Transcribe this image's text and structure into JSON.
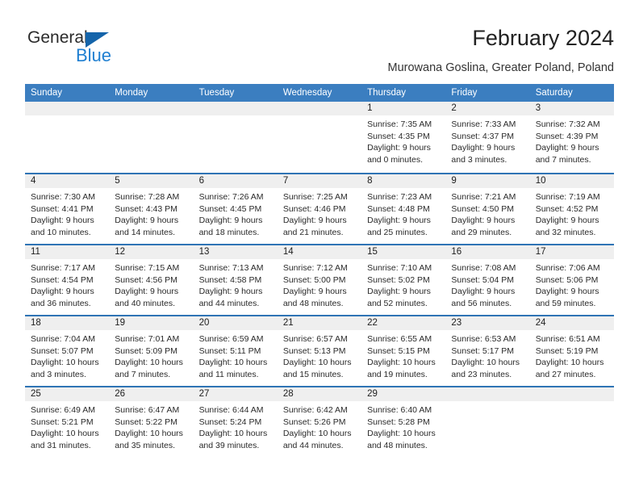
{
  "brand": {
    "name_part1": "General",
    "name_part2": "Blue",
    "accent_color": "#1f7fd1",
    "triangle_color": "#1464aa"
  },
  "header": {
    "title": "February 2024",
    "location": "Murowana Goslina, Greater Poland, Poland"
  },
  "theme": {
    "header_row_bg": "#3b7ec0",
    "week_separator": "#2f74b5",
    "day_band_bg": "#efefef"
  },
  "weekdays": [
    "Sunday",
    "Monday",
    "Tuesday",
    "Wednesday",
    "Thursday",
    "Friday",
    "Saturday"
  ],
  "weeks": [
    [
      {
        "day": "",
        "lines": []
      },
      {
        "day": "",
        "lines": []
      },
      {
        "day": "",
        "lines": []
      },
      {
        "day": "",
        "lines": []
      },
      {
        "day": "1",
        "lines": [
          "Sunrise: 7:35 AM",
          "Sunset: 4:35 PM",
          "Daylight: 9 hours",
          "and 0 minutes."
        ]
      },
      {
        "day": "2",
        "lines": [
          "Sunrise: 7:33 AM",
          "Sunset: 4:37 PM",
          "Daylight: 9 hours",
          "and 3 minutes."
        ]
      },
      {
        "day": "3",
        "lines": [
          "Sunrise: 7:32 AM",
          "Sunset: 4:39 PM",
          "Daylight: 9 hours",
          "and 7 minutes."
        ]
      }
    ],
    [
      {
        "day": "4",
        "lines": [
          "Sunrise: 7:30 AM",
          "Sunset: 4:41 PM",
          "Daylight: 9 hours",
          "and 10 minutes."
        ]
      },
      {
        "day": "5",
        "lines": [
          "Sunrise: 7:28 AM",
          "Sunset: 4:43 PM",
          "Daylight: 9 hours",
          "and 14 minutes."
        ]
      },
      {
        "day": "6",
        "lines": [
          "Sunrise: 7:26 AM",
          "Sunset: 4:45 PM",
          "Daylight: 9 hours",
          "and 18 minutes."
        ]
      },
      {
        "day": "7",
        "lines": [
          "Sunrise: 7:25 AM",
          "Sunset: 4:46 PM",
          "Daylight: 9 hours",
          "and 21 minutes."
        ]
      },
      {
        "day": "8",
        "lines": [
          "Sunrise: 7:23 AM",
          "Sunset: 4:48 PM",
          "Daylight: 9 hours",
          "and 25 minutes."
        ]
      },
      {
        "day": "9",
        "lines": [
          "Sunrise: 7:21 AM",
          "Sunset: 4:50 PM",
          "Daylight: 9 hours",
          "and 29 minutes."
        ]
      },
      {
        "day": "10",
        "lines": [
          "Sunrise: 7:19 AM",
          "Sunset: 4:52 PM",
          "Daylight: 9 hours",
          "and 32 minutes."
        ]
      }
    ],
    [
      {
        "day": "11",
        "lines": [
          "Sunrise: 7:17 AM",
          "Sunset: 4:54 PM",
          "Daylight: 9 hours",
          "and 36 minutes."
        ]
      },
      {
        "day": "12",
        "lines": [
          "Sunrise: 7:15 AM",
          "Sunset: 4:56 PM",
          "Daylight: 9 hours",
          "and 40 minutes."
        ]
      },
      {
        "day": "13",
        "lines": [
          "Sunrise: 7:13 AM",
          "Sunset: 4:58 PM",
          "Daylight: 9 hours",
          "and 44 minutes."
        ]
      },
      {
        "day": "14",
        "lines": [
          "Sunrise: 7:12 AM",
          "Sunset: 5:00 PM",
          "Daylight: 9 hours",
          "and 48 minutes."
        ]
      },
      {
        "day": "15",
        "lines": [
          "Sunrise: 7:10 AM",
          "Sunset: 5:02 PM",
          "Daylight: 9 hours",
          "and 52 minutes."
        ]
      },
      {
        "day": "16",
        "lines": [
          "Sunrise: 7:08 AM",
          "Sunset: 5:04 PM",
          "Daylight: 9 hours",
          "and 56 minutes."
        ]
      },
      {
        "day": "17",
        "lines": [
          "Sunrise: 7:06 AM",
          "Sunset: 5:06 PM",
          "Daylight: 9 hours",
          "and 59 minutes."
        ]
      }
    ],
    [
      {
        "day": "18",
        "lines": [
          "Sunrise: 7:04 AM",
          "Sunset: 5:07 PM",
          "Daylight: 10 hours",
          "and 3 minutes."
        ]
      },
      {
        "day": "19",
        "lines": [
          "Sunrise: 7:01 AM",
          "Sunset: 5:09 PM",
          "Daylight: 10 hours",
          "and 7 minutes."
        ]
      },
      {
        "day": "20",
        "lines": [
          "Sunrise: 6:59 AM",
          "Sunset: 5:11 PM",
          "Daylight: 10 hours",
          "and 11 minutes."
        ]
      },
      {
        "day": "21",
        "lines": [
          "Sunrise: 6:57 AM",
          "Sunset: 5:13 PM",
          "Daylight: 10 hours",
          "and 15 minutes."
        ]
      },
      {
        "day": "22",
        "lines": [
          "Sunrise: 6:55 AM",
          "Sunset: 5:15 PM",
          "Daylight: 10 hours",
          "and 19 minutes."
        ]
      },
      {
        "day": "23",
        "lines": [
          "Sunrise: 6:53 AM",
          "Sunset: 5:17 PM",
          "Daylight: 10 hours",
          "and 23 minutes."
        ]
      },
      {
        "day": "24",
        "lines": [
          "Sunrise: 6:51 AM",
          "Sunset: 5:19 PM",
          "Daylight: 10 hours",
          "and 27 minutes."
        ]
      }
    ],
    [
      {
        "day": "25",
        "lines": [
          "Sunrise: 6:49 AM",
          "Sunset: 5:21 PM",
          "Daylight: 10 hours",
          "and 31 minutes."
        ]
      },
      {
        "day": "26",
        "lines": [
          "Sunrise: 6:47 AM",
          "Sunset: 5:22 PM",
          "Daylight: 10 hours",
          "and 35 minutes."
        ]
      },
      {
        "day": "27",
        "lines": [
          "Sunrise: 6:44 AM",
          "Sunset: 5:24 PM",
          "Daylight: 10 hours",
          "and 39 minutes."
        ]
      },
      {
        "day": "28",
        "lines": [
          "Sunrise: 6:42 AM",
          "Sunset: 5:26 PM",
          "Daylight: 10 hours",
          "and 44 minutes."
        ]
      },
      {
        "day": "29",
        "lines": [
          "Sunrise: 6:40 AM",
          "Sunset: 5:28 PM",
          "Daylight: 10 hours",
          "and 48 minutes."
        ]
      },
      {
        "day": "",
        "lines": []
      },
      {
        "day": "",
        "lines": []
      }
    ]
  ]
}
